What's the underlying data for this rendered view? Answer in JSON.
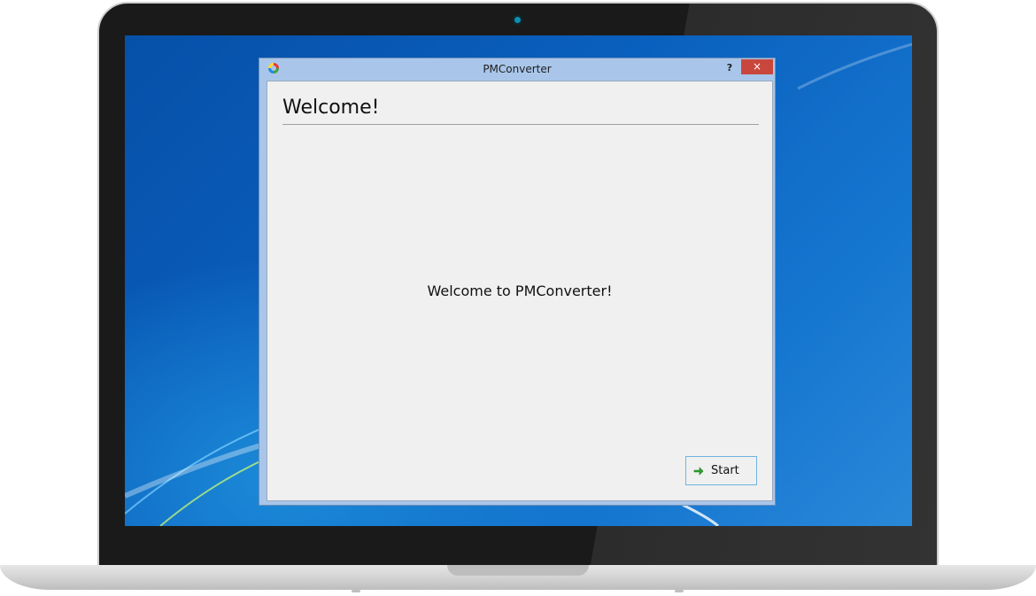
{
  "window": {
    "title": "PMConverter",
    "help_label": "?",
    "close_label": "×"
  },
  "page": {
    "heading": "Welcome!",
    "message": "Welcome to PMConverter!"
  },
  "buttons": {
    "start_label": "Start"
  },
  "icons": {
    "app": "pmconverter-app-icon",
    "start": "green-arrow-right-icon"
  },
  "colors": {
    "titlebar": "#a9c6ea",
    "close_button": "#c9463d",
    "client_bg": "#f0f0f0",
    "desktop": "#0a5fbd"
  }
}
